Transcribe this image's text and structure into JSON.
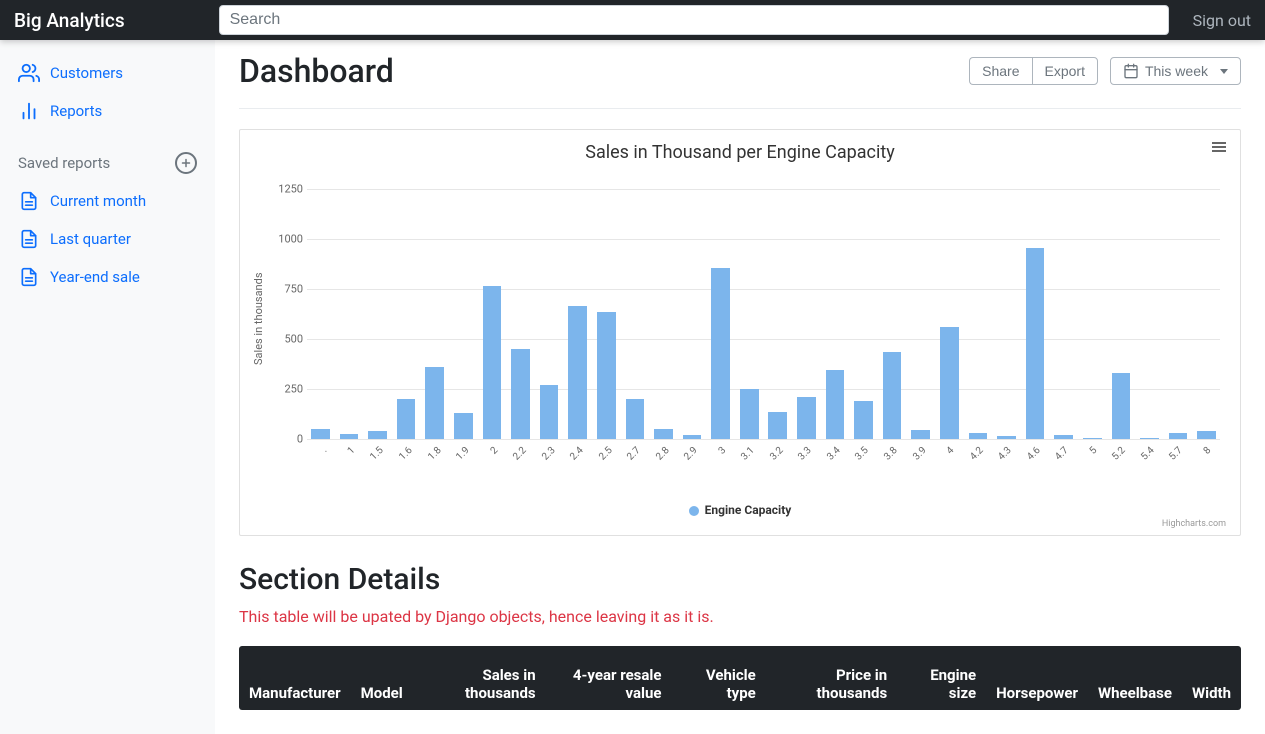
{
  "brand": "Big Analytics",
  "search": {
    "placeholder": "Search"
  },
  "signout": "Sign out",
  "sidebar": {
    "nav": [
      {
        "label": "Customers",
        "icon": "users"
      },
      {
        "label": "Reports",
        "icon": "bars"
      }
    ],
    "saved_header": "Saved reports",
    "saved": [
      {
        "label": "Current month"
      },
      {
        "label": "Last quarter"
      },
      {
        "label": "Year-end sale"
      }
    ]
  },
  "page": {
    "title": "Dashboard",
    "share": "Share",
    "export": "Export",
    "range": "This week"
  },
  "chart_data": {
    "type": "bar",
    "title": "Sales in Thousand per Engine Capacity",
    "ylabel": "Sales in thousands",
    "xlabel": "",
    "ylim": [
      0,
      1300
    ],
    "yticks": [
      0,
      250,
      500,
      750,
      1000,
      1250
    ],
    "legend": "Engine Capacity",
    "credit": "Highcharts.com",
    "categories": [
      ".",
      "1",
      "1.5",
      "1.6",
      "1.8",
      "1.9",
      "2",
      "2.2",
      "2.3",
      "2.4",
      "2.5",
      "2.7",
      "2.8",
      "2.9",
      "3",
      "3.1",
      "3.2",
      "3.3",
      "3.4",
      "3.5",
      "3.8",
      "3.9",
      "4",
      "4.2",
      "4.3",
      "4.6",
      "4.7",
      "5",
      "5.2",
      "5.4",
      "5.7",
      "8"
    ],
    "values": [
      50,
      25,
      40,
      200,
      360,
      130,
      765,
      450,
      270,
      665,
      635,
      200,
      50,
      20,
      855,
      250,
      135,
      210,
      345,
      190,
      435,
      45,
      560,
      30,
      15,
      955,
      20,
      5,
      330,
      5,
      30,
      40
    ]
  },
  "section": {
    "title": "Section Details",
    "note": "This table will be upated by Django objects, hence leaving it as it is.",
    "columns": [
      "Manufacturer",
      "Model",
      "Sales in thousands",
      "4-year resale value",
      "Vehicle type",
      "Price in thousands",
      "Engine size",
      "Horsepower",
      "Wheelbase",
      "Width"
    ]
  }
}
